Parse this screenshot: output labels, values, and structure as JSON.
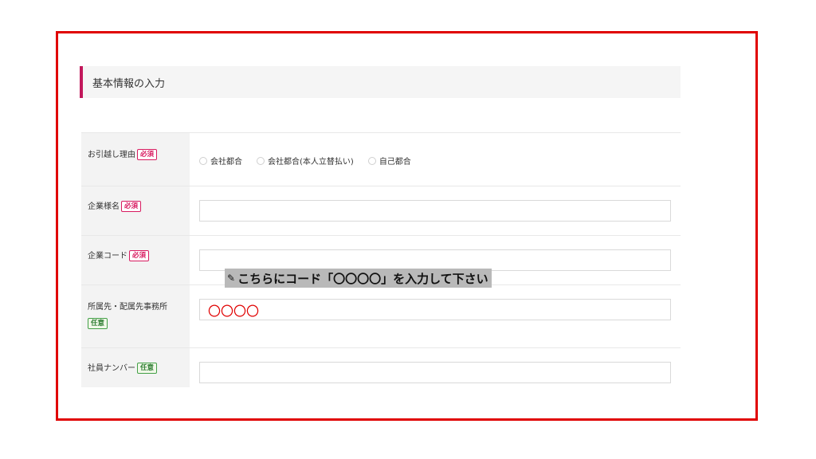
{
  "section": {
    "title": "基本情報の入力"
  },
  "badges": {
    "required": "必須",
    "optional": "任意"
  },
  "fields": {
    "reason": {
      "label": "お引越し理由",
      "options": [
        "会社都合",
        "会社都合(本人立替払い)",
        "自己都合"
      ]
    },
    "company_name": {
      "label": "企業様名",
      "value": ""
    },
    "company_code": {
      "label": "企業コード",
      "value": ""
    },
    "department": {
      "label": "所属先・配属先事務所",
      "value": "〇〇〇〇"
    },
    "employee_number": {
      "label": "社員ナンバー",
      "value": ""
    }
  },
  "tooltip": {
    "text": "こちらにコード「〇〇〇〇」を入力して下さい",
    "icon": "pen-icon"
  },
  "colors": {
    "frame": "#e00000",
    "accent": "#c2185b",
    "required": "#d81b60",
    "optional": "#2e7d32"
  }
}
